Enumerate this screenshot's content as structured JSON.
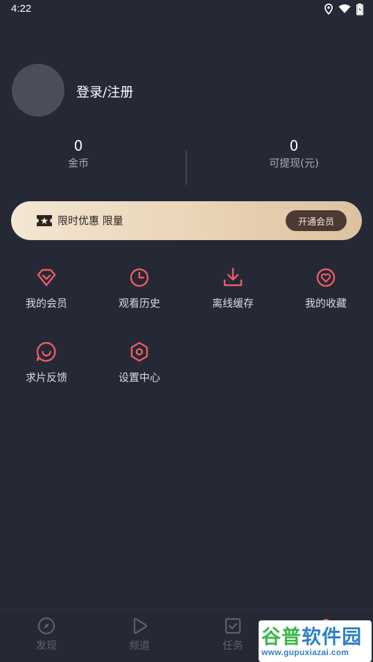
{
  "status_bar": {
    "time": "4:22",
    "icons": [
      "location-icon",
      "wifi-icon",
      "battery-icon"
    ]
  },
  "profile": {
    "login_label": "登录/注册"
  },
  "stats": {
    "coins": {
      "value": "0",
      "label": "金币"
    },
    "withdrawable": {
      "value": "0",
      "label": "可提现(元)"
    }
  },
  "vip_banner": {
    "text": "限时优惠 限量",
    "button_label": "开通会员",
    "icon": "ticket-star-icon"
  },
  "menu": {
    "items": [
      {
        "label": "我的会员",
        "icon": "diamond-icon"
      },
      {
        "label": "观看历史",
        "icon": "clock-icon"
      },
      {
        "label": "离线缓存",
        "icon": "download-icon"
      },
      {
        "label": "我的收藏",
        "icon": "heart-icon"
      },
      {
        "label": "求片反馈",
        "icon": "feedback-smile-icon"
      },
      {
        "label": "设置中心",
        "icon": "settings-hexagon-icon"
      }
    ]
  },
  "bottom_nav": {
    "items": [
      {
        "label": "发现",
        "icon": "compass-icon"
      },
      {
        "label": "频道",
        "icon": "play-icon"
      },
      {
        "label": "任务",
        "icon": "task-check-icon"
      },
      {
        "label": "",
        "icon": "profile-icon"
      }
    ]
  },
  "watermark": {
    "title": "谷普软件园",
    "url": "www.gupuxiazai.com"
  },
  "colors": {
    "background": "#252936",
    "accent": "#ee5c65",
    "vip_gold": "#e8d2b3",
    "vip_button": "#4a3a33"
  }
}
